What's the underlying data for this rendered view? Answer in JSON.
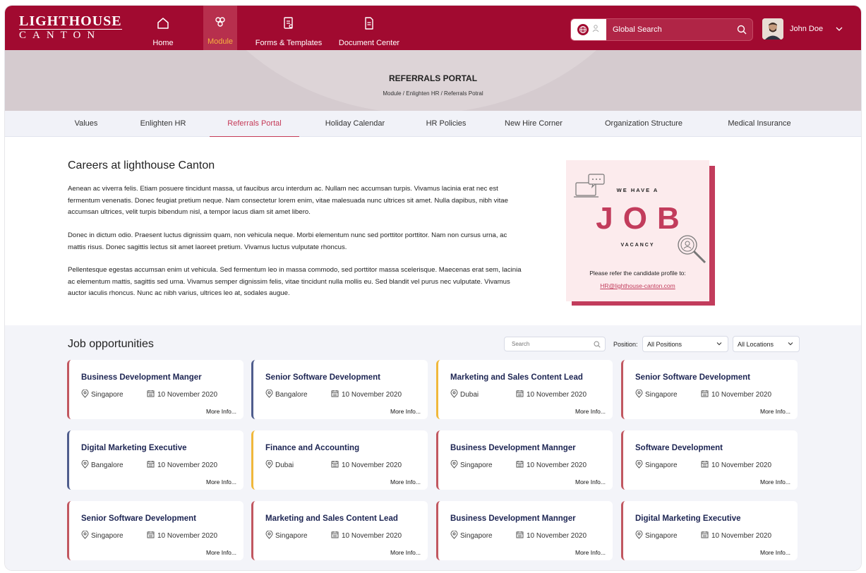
{
  "header": {
    "logo_line1": "LIGHTHOUSE",
    "logo_line2": "CANTON",
    "nav": [
      {
        "label": "Home",
        "icon": "home-icon"
      },
      {
        "label": "Module",
        "icon": "module-icon",
        "active": true
      },
      {
        "label": "Forms & Templates",
        "icon": "forms-icon"
      },
      {
        "label": "Document Center",
        "icon": "document-icon"
      }
    ],
    "search_placeholder": "Global Search",
    "user_name": "John Doe",
    "colors": {
      "brand": "#a10a30",
      "active_nav_text": "#f6b23e"
    }
  },
  "hero": {
    "title": "REFERRALS PORTAL",
    "breadcrumb": "Module / Enlighten HR / Referrals Potral"
  },
  "subtabs": [
    {
      "label": "Values"
    },
    {
      "label": "Enlighten HR"
    },
    {
      "label": "Referrals Portal",
      "active": true
    },
    {
      "label": "Holiday Calendar"
    },
    {
      "label": "HR Policies"
    },
    {
      "label": "New Hire Corner"
    },
    {
      "label": "Organization Structure"
    },
    {
      "label": "Medical Insurance"
    }
  ],
  "careers": {
    "title": "Careers at lighthouse Canton",
    "paragraphs": [
      "Aenean ac viverra felis. Etiam posuere tincidunt massa, ut faucibus arcu interdum ac. Nullam nec accumsan turpis. Vivamus lacinia erat nec est fermentum venenatis. Donec feugiat pretium neque. Nam consectetur lorem enim, vitae malesuada nunc ultrices sit amet. Nulla dapibus, nibh vitae accumsan ultrices, velit turpis bibendum nisl, a tempor lacus diam sit amet libero.",
      "Donec in dictum odio. Praesent luctus dignissim quam, non vehicula neque. Morbi elementum nunc sed porttitor porttitor. Nam non cursus urna, ac mattis risus. Donec sagittis lectus sit amet laoreet pretium. Vivamus luctus vulputate rhoncus.",
      "Pellentesque egestas accumsan enim ut vehicula. Sed fermentum leo in massa commodo, sed porttitor massa scelerisque. Maecenas erat sem, lacinia ac elementum mattis, sagittis sed urna. Vivamus semper dignissim felis, vitae tincidunt nulla mollis eu. Sed blandit vel purus nec vulputate. Vivamus auctor iaculis rhoncus. Nunc ac nibh varius, ultrices leo at, sodales augue."
    ]
  },
  "vacancy": {
    "we_have_a": "WE HAVE A",
    "job": "JOB",
    "vacancy": "VACANCY",
    "refer_text": "Please refer the candidate profile to:",
    "email": "HR@lighthouse-canton.com"
  },
  "jobs": {
    "title": "Job opportunities",
    "search_placeholder": "Search",
    "position_label": "Position:",
    "position_value": "All Positions",
    "location_value": "All Locations",
    "more_label": "More Info...",
    "cards": [
      {
        "title": "Business Development Manger",
        "location": "Singapore",
        "date": "10 November 2020",
        "accent": "red"
      },
      {
        "title": "Senior Software Development",
        "location": "Bangalore",
        "date": "10 November 2020",
        "accent": "navy"
      },
      {
        "title": "Marketing and Sales Content Lead",
        "location": "Dubai",
        "date": "10 November 2020",
        "accent": "yellow"
      },
      {
        "title": "Senior Software Development",
        "location": "Singapore",
        "date": "10 November 2020",
        "accent": "red"
      },
      {
        "title": "Digital Marketing Executive",
        "location": "Bangalore",
        "date": "10 November 2020",
        "accent": "navy"
      },
      {
        "title": "Finance and Accounting",
        "location": "Dubai",
        "date": "10 November 2020",
        "accent": "yellow"
      },
      {
        "title": "Business Development Mannger",
        "location": "Singapore",
        "date": "10 November 2020",
        "accent": "red"
      },
      {
        "title": "Software Development",
        "location": "Singapore",
        "date": "10 November 2020",
        "accent": "red"
      },
      {
        "title": "Senior Software Development",
        "location": "Singapore",
        "date": "10 November 2020",
        "accent": "red"
      },
      {
        "title": "Marketing and Sales Content Lead",
        "location": "Singapore",
        "date": "10 November 2020",
        "accent": "red"
      },
      {
        "title": "Business Development Mannger",
        "location": "Singapore",
        "date": "10 November 2020",
        "accent": "red"
      },
      {
        "title": "Digital Marketing Executive",
        "location": "Singapore",
        "date": "10 November 2020",
        "accent": "red"
      }
    ]
  }
}
